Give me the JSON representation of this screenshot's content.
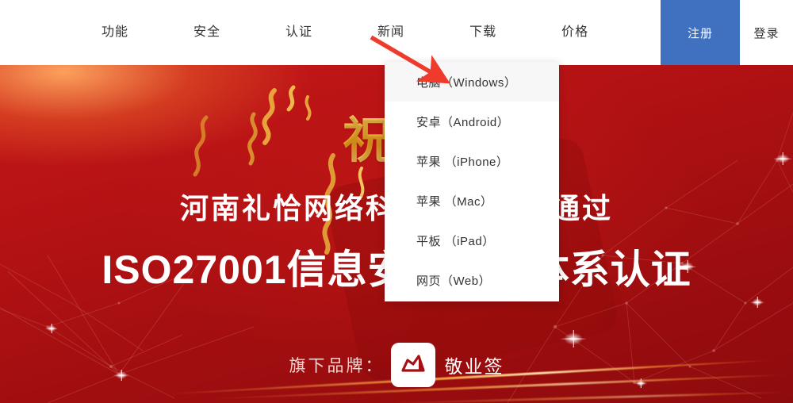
{
  "nav": {
    "links": [
      {
        "label": "功能",
        "name": "nav-item-features"
      },
      {
        "label": "安全",
        "name": "nav-item-security"
      },
      {
        "label": "认证",
        "name": "nav-item-certification"
      },
      {
        "label": "新闻",
        "name": "nav-item-news"
      },
      {
        "label": "下载",
        "name": "nav-item-download"
      },
      {
        "label": "价格",
        "name": "nav-item-pricing"
      }
    ],
    "register_label": "注册",
    "login_label": "登录",
    "register_bg": "#4070c0"
  },
  "dropdown": {
    "open_for": "下载",
    "items": [
      {
        "label": "电脑（Windows）",
        "active": true
      },
      {
        "label": "安卓（Android）",
        "active": false
      },
      {
        "label": "苹果 （iPhone）",
        "active": false
      },
      {
        "label": "苹果 （Mac）",
        "active": false
      },
      {
        "label": "平板 （iPad）",
        "active": false
      },
      {
        "label": "网页（Web）",
        "active": false
      }
    ]
  },
  "banner": {
    "gold_title": "祝贺",
    "line1": "河南礼恰网络科技有限公司通过",
    "line2": "ISO27001信息安全管理体系认证",
    "bg_color": "#b01113",
    "gold_color": "#f3c94f"
  },
  "brand": {
    "label": "旗下品牌：",
    "logo_icon": "jingyeqian-logo-icon",
    "name": "敬业签"
  },
  "annotation": {
    "arrow_color": "#ef3b2c",
    "arrow_from": "468,48",
    "arrow_to": "552,97"
  }
}
